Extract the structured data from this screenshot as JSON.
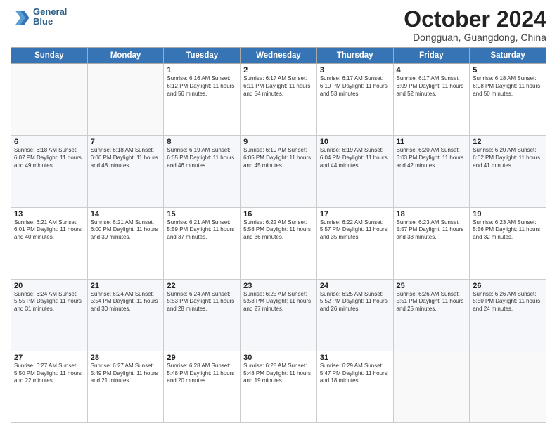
{
  "logo": {
    "line1": "General",
    "line2": "Blue"
  },
  "title": "October 2024",
  "subtitle": "Dongguan, Guangdong, China",
  "headers": [
    "Sunday",
    "Monday",
    "Tuesday",
    "Wednesday",
    "Thursday",
    "Friday",
    "Saturday"
  ],
  "weeks": [
    [
      {
        "day": "",
        "info": ""
      },
      {
        "day": "",
        "info": ""
      },
      {
        "day": "1",
        "info": "Sunrise: 6:16 AM\nSunset: 6:12 PM\nDaylight: 11 hours and 56 minutes."
      },
      {
        "day": "2",
        "info": "Sunrise: 6:17 AM\nSunset: 6:11 PM\nDaylight: 11 hours and 54 minutes."
      },
      {
        "day": "3",
        "info": "Sunrise: 6:17 AM\nSunset: 6:10 PM\nDaylight: 11 hours and 53 minutes."
      },
      {
        "day": "4",
        "info": "Sunrise: 6:17 AM\nSunset: 6:09 PM\nDaylight: 11 hours and 52 minutes."
      },
      {
        "day": "5",
        "info": "Sunrise: 6:18 AM\nSunset: 6:08 PM\nDaylight: 11 hours and 50 minutes."
      }
    ],
    [
      {
        "day": "6",
        "info": "Sunrise: 6:18 AM\nSunset: 6:07 PM\nDaylight: 11 hours and 49 minutes."
      },
      {
        "day": "7",
        "info": "Sunrise: 6:18 AM\nSunset: 6:06 PM\nDaylight: 11 hours and 48 minutes."
      },
      {
        "day": "8",
        "info": "Sunrise: 6:19 AM\nSunset: 6:05 PM\nDaylight: 11 hours and 46 minutes."
      },
      {
        "day": "9",
        "info": "Sunrise: 6:19 AM\nSunset: 6:05 PM\nDaylight: 11 hours and 45 minutes."
      },
      {
        "day": "10",
        "info": "Sunrise: 6:19 AM\nSunset: 6:04 PM\nDaylight: 11 hours and 44 minutes."
      },
      {
        "day": "11",
        "info": "Sunrise: 6:20 AM\nSunset: 6:03 PM\nDaylight: 11 hours and 42 minutes."
      },
      {
        "day": "12",
        "info": "Sunrise: 6:20 AM\nSunset: 6:02 PM\nDaylight: 11 hours and 41 minutes."
      }
    ],
    [
      {
        "day": "13",
        "info": "Sunrise: 6:21 AM\nSunset: 6:01 PM\nDaylight: 11 hours and 40 minutes."
      },
      {
        "day": "14",
        "info": "Sunrise: 6:21 AM\nSunset: 6:00 PM\nDaylight: 11 hours and 39 minutes."
      },
      {
        "day": "15",
        "info": "Sunrise: 6:21 AM\nSunset: 5:59 PM\nDaylight: 11 hours and 37 minutes."
      },
      {
        "day": "16",
        "info": "Sunrise: 6:22 AM\nSunset: 5:58 PM\nDaylight: 11 hours and 36 minutes."
      },
      {
        "day": "17",
        "info": "Sunrise: 6:22 AM\nSunset: 5:57 PM\nDaylight: 11 hours and 35 minutes."
      },
      {
        "day": "18",
        "info": "Sunrise: 6:23 AM\nSunset: 5:57 PM\nDaylight: 11 hours and 33 minutes."
      },
      {
        "day": "19",
        "info": "Sunrise: 6:23 AM\nSunset: 5:56 PM\nDaylight: 11 hours and 32 minutes."
      }
    ],
    [
      {
        "day": "20",
        "info": "Sunrise: 6:24 AM\nSunset: 5:55 PM\nDaylight: 11 hours and 31 minutes."
      },
      {
        "day": "21",
        "info": "Sunrise: 6:24 AM\nSunset: 5:54 PM\nDaylight: 11 hours and 30 minutes."
      },
      {
        "day": "22",
        "info": "Sunrise: 6:24 AM\nSunset: 5:53 PM\nDaylight: 11 hours and 28 minutes."
      },
      {
        "day": "23",
        "info": "Sunrise: 6:25 AM\nSunset: 5:53 PM\nDaylight: 11 hours and 27 minutes."
      },
      {
        "day": "24",
        "info": "Sunrise: 6:25 AM\nSunset: 5:52 PM\nDaylight: 11 hours and 26 minutes."
      },
      {
        "day": "25",
        "info": "Sunrise: 6:26 AM\nSunset: 5:51 PM\nDaylight: 11 hours and 25 minutes."
      },
      {
        "day": "26",
        "info": "Sunrise: 6:26 AM\nSunset: 5:50 PM\nDaylight: 11 hours and 24 minutes."
      }
    ],
    [
      {
        "day": "27",
        "info": "Sunrise: 6:27 AM\nSunset: 5:50 PM\nDaylight: 11 hours and 22 minutes."
      },
      {
        "day": "28",
        "info": "Sunrise: 6:27 AM\nSunset: 5:49 PM\nDaylight: 11 hours and 21 minutes."
      },
      {
        "day": "29",
        "info": "Sunrise: 6:28 AM\nSunset: 5:48 PM\nDaylight: 11 hours and 20 minutes."
      },
      {
        "day": "30",
        "info": "Sunrise: 6:28 AM\nSunset: 5:48 PM\nDaylight: 11 hours and 19 minutes."
      },
      {
        "day": "31",
        "info": "Sunrise: 6:29 AM\nSunset: 5:47 PM\nDaylight: 11 hours and 18 minutes."
      },
      {
        "day": "",
        "info": ""
      },
      {
        "day": "",
        "info": ""
      }
    ]
  ]
}
